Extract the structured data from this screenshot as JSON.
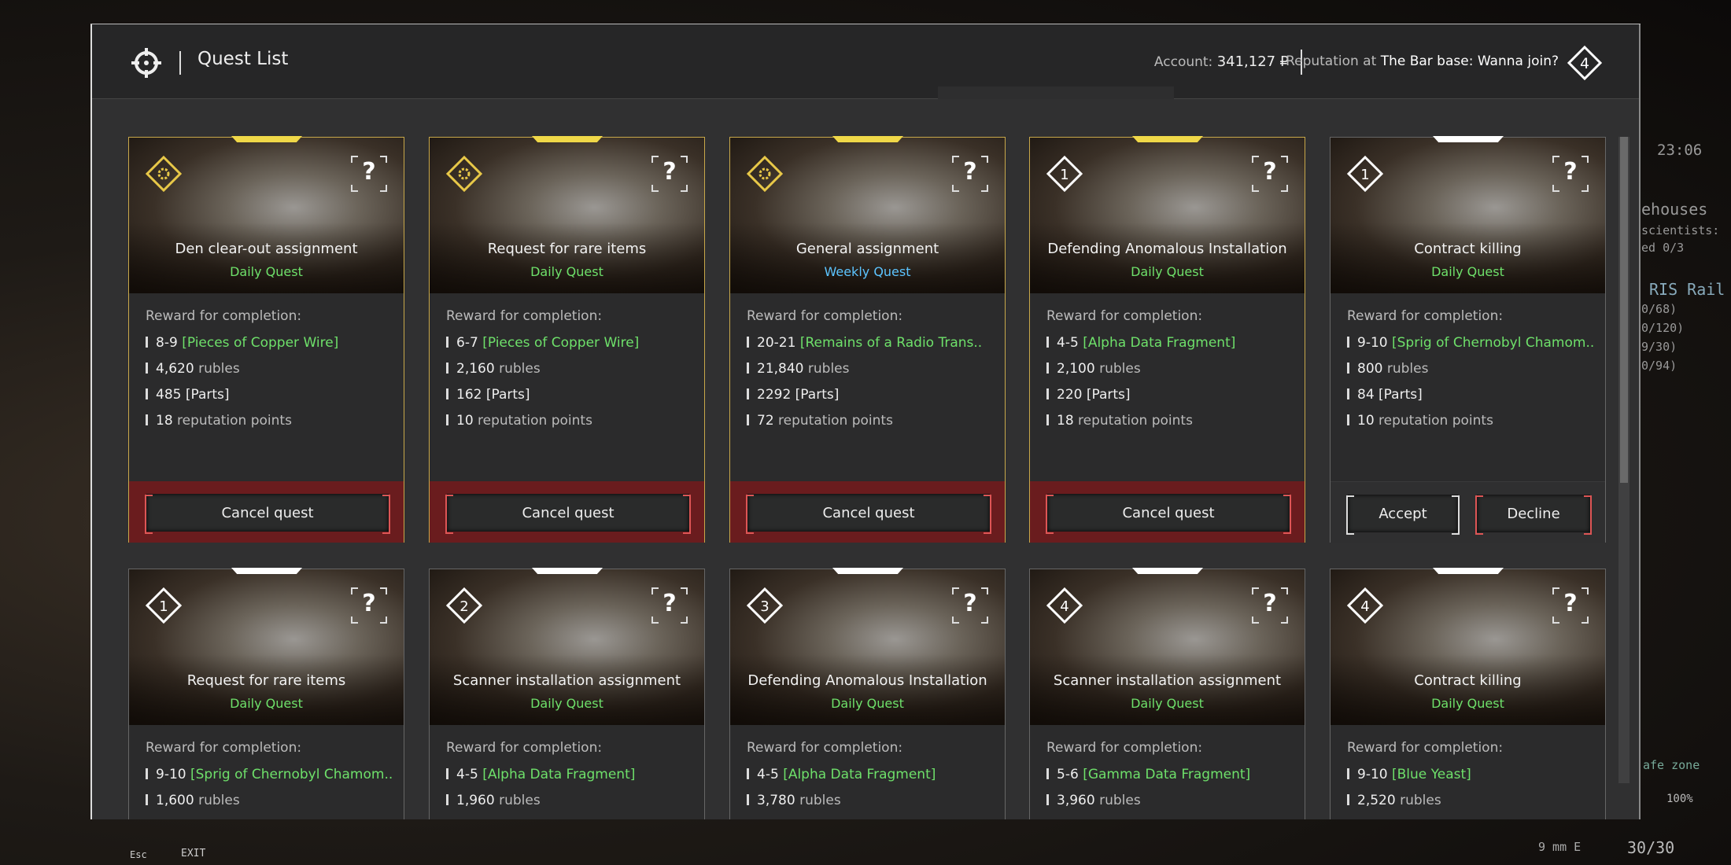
{
  "header": {
    "title": "Quest List",
    "account_label": "Account:",
    "account_value": "341,127",
    "currency": "₽",
    "rep_prefix": "Reputation at",
    "rep_faction": "The Bar base: Wanna join?",
    "rep_level": "4"
  },
  "colors": {
    "active_border": "#c8a84a",
    "daily": "#6ee06a",
    "weekly": "#5cc4ff",
    "cancel_band": "#6a1c1e"
  },
  "reward_label": "Reward for completion:",
  "quests": [
    {
      "title": "Den clear-out assignment",
      "type": "Daily Quest",
      "badge": "gear",
      "active": true,
      "rewards": [
        {
          "qty": "8-9",
          "item": "[Pieces of Copper Wire]"
        },
        {
          "qty": "4,620",
          "unit": "rubles"
        },
        {
          "qty": "485",
          "item2": "[Parts]"
        },
        {
          "qty": "18",
          "unit": "reputation points"
        }
      ],
      "buttons": [
        "Cancel quest"
      ]
    },
    {
      "title": "Request for rare items",
      "type": "Daily Quest",
      "badge": "gear",
      "active": true,
      "rewards": [
        {
          "qty": "6-7",
          "item": "[Pieces of Copper Wire]"
        },
        {
          "qty": "2,160",
          "unit": "rubles"
        },
        {
          "qty": "162",
          "item2": "[Parts]"
        },
        {
          "qty": "10",
          "unit": "reputation points"
        }
      ],
      "buttons": [
        "Cancel quest"
      ]
    },
    {
      "title": "General assignment",
      "type": "Weekly Quest",
      "badge": "gear",
      "active": true,
      "rewards": [
        {
          "qty": "20-21",
          "item": "[Remains of a Radio Trans.."
        },
        {
          "qty": "21,840",
          "unit": "rubles"
        },
        {
          "qty": "2292",
          "item2": "[Parts]"
        },
        {
          "qty": "72",
          "unit": "reputation points"
        }
      ],
      "buttons": [
        "Cancel quest"
      ]
    },
    {
      "title": "Defending Anomalous Installation",
      "type": "Daily Quest",
      "badge": "1",
      "active": true,
      "rewards": [
        {
          "qty": "4-5",
          "item": "[Alpha Data Fragment]"
        },
        {
          "qty": "2,100",
          "unit": "rubles"
        },
        {
          "qty": "220",
          "item2": "[Parts]"
        },
        {
          "qty": "18",
          "unit": "reputation points"
        }
      ],
      "buttons": [
        "Cancel quest"
      ]
    },
    {
      "title": "Contract killing",
      "type": "Daily Quest",
      "badge": "1",
      "active": false,
      "rewards": [
        {
          "qty": "9-10",
          "item": "[Sprig of Chernobyl Chamom.."
        },
        {
          "qty": "800",
          "unit": "rubles"
        },
        {
          "qty": "84",
          "item2": "[Parts]"
        },
        {
          "qty": "10",
          "unit": "reputation points"
        }
      ],
      "buttons": [
        "Accept",
        "Decline"
      ]
    },
    {
      "title": "Request for rare items",
      "type": "Daily Quest",
      "badge": "1",
      "active": false,
      "rewards": [
        {
          "qty": "9-10",
          "item": "[Sprig of Chernobyl Chamom.."
        },
        {
          "qty": "1,600",
          "unit": "rubles"
        }
      ],
      "buttons": []
    },
    {
      "title": "Scanner installation assignment",
      "type": "Daily Quest",
      "badge": "2",
      "active": false,
      "rewards": [
        {
          "qty": "4-5",
          "item": "[Alpha Data Fragment]"
        },
        {
          "qty": "1,960",
          "unit": "rubles"
        }
      ],
      "buttons": []
    },
    {
      "title": "Defending Anomalous Installation",
      "type": "Daily Quest",
      "badge": "3",
      "active": false,
      "rewards": [
        {
          "qty": "4-5",
          "item": "[Alpha Data Fragment]"
        },
        {
          "qty": "3,780",
          "unit": "rubles"
        }
      ],
      "buttons": []
    },
    {
      "title": "Scanner installation assignment",
      "type": "Daily Quest",
      "badge": "4",
      "active": false,
      "rewards": [
        {
          "qty": "5-6",
          "item": "[Gamma Data Fragment]"
        },
        {
          "qty": "3,960",
          "unit": "rubles"
        }
      ],
      "buttons": []
    },
    {
      "title": "Contract killing",
      "type": "Daily Quest",
      "badge": "4",
      "active": false,
      "rewards": [
        {
          "qty": "9-10",
          "item": "[Blue Yeast]"
        },
        {
          "qty": "2,520",
          "unit": "rubles"
        }
      ],
      "buttons": []
    }
  ],
  "hud": {
    "time": "23:06",
    "lines": [
      "ehouses",
      "scientists:",
      "ed 0/3",
      "RIS Rail",
      "0/68)",
      "0/120)",
      "9/30)",
      "0/94)"
    ],
    "safe_zone": "afe zone",
    "health": "100%",
    "ammo_type": "9 mm E",
    "ammo": "30/30",
    "esc": "Esc",
    "exit": "EXIT"
  }
}
